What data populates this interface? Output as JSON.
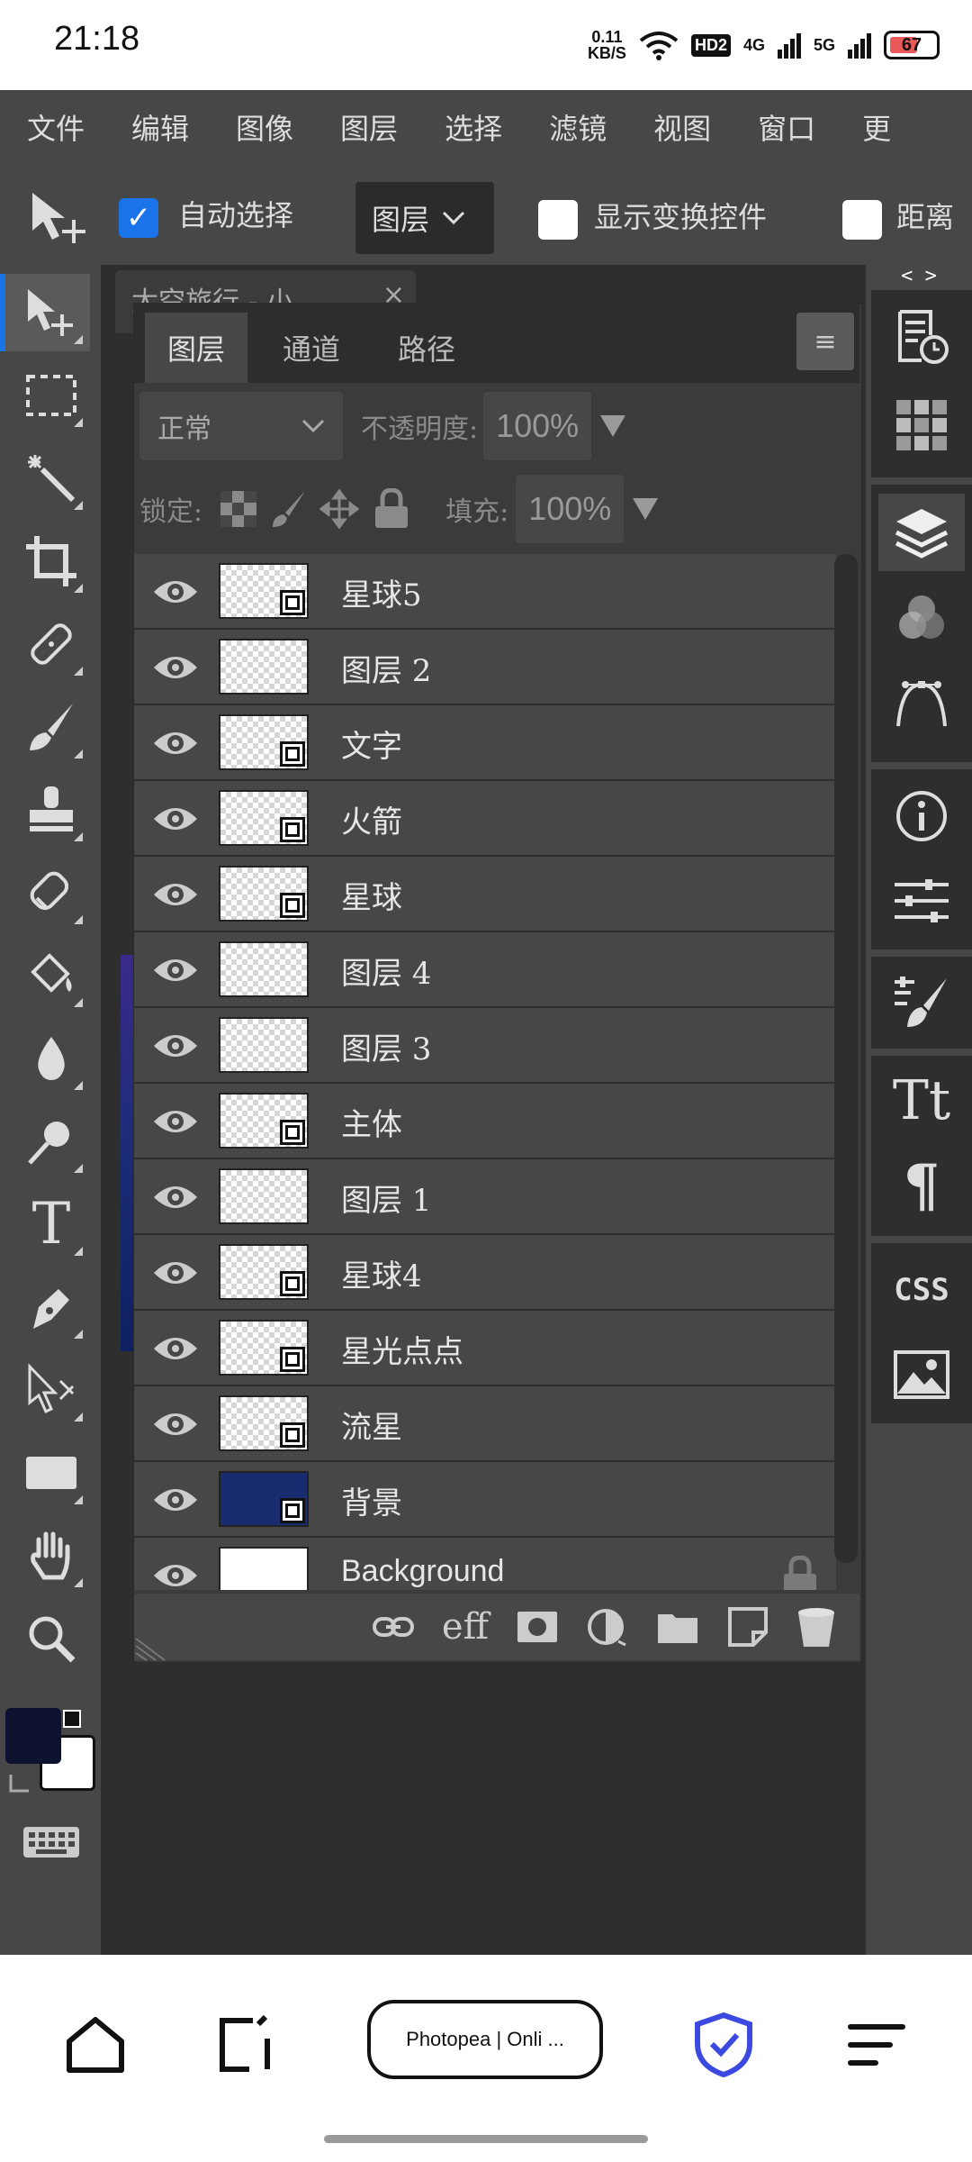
{
  "status": {
    "time": "21:18",
    "net_speed": "0.11",
    "net_unit": "KB/S",
    "hd": "HD2",
    "sig1": "4G",
    "sig2": "5G",
    "battery": "67"
  },
  "menu": [
    "文件",
    "编辑",
    "图像",
    "图层",
    "选择",
    "滤镜",
    "视图",
    "窗口",
    "更"
  ],
  "options": {
    "auto_select_label": "自动选择",
    "auto_select_checked": true,
    "target": "图层",
    "show_transform_label": "显示变换控件",
    "distance_label": "距离"
  },
  "document_tab": {
    "title": "太空旅行 - 小",
    "close": "×"
  },
  "panel": {
    "tabs": [
      "图层",
      "通道",
      "路径"
    ],
    "menu_icon": "≡",
    "blend_mode": "正常",
    "opacity_label": "不透明度:",
    "opacity": "100%",
    "lock_label": "锁定:",
    "fill_label": "填充:",
    "fill": "100%",
    "layers": [
      {
        "name": "星球5",
        "thumb": "checker",
        "smart": true
      },
      {
        "name": "图层 2",
        "thumb": "checker",
        "smart": false
      },
      {
        "name": "文字",
        "thumb": "checker",
        "smart": true
      },
      {
        "name": "火箭",
        "thumb": "checker",
        "smart": true
      },
      {
        "name": "星球",
        "thumb": "checker",
        "smart": true
      },
      {
        "name": "图层 4",
        "thumb": "checker",
        "smart": false
      },
      {
        "name": "图层 3",
        "thumb": "checker",
        "smart": false
      },
      {
        "name": "主体",
        "thumb": "checker",
        "smart": true
      },
      {
        "name": "图层 1",
        "thumb": "checker",
        "smart": false
      },
      {
        "name": "星球4",
        "thumb": "checker",
        "smart": true
      },
      {
        "name": "星光点点",
        "thumb": "checker",
        "smart": true
      },
      {
        "name": "流星",
        "thumb": "checker",
        "smart": true
      },
      {
        "name": "背景",
        "thumb": "dark",
        "smart": true
      },
      {
        "name": "Background",
        "thumb": "plain",
        "smart": false,
        "locked": true
      }
    ],
    "footer_icons": [
      "link-icon",
      "effects-icon",
      "mask-icon",
      "adjustment-icon",
      "folder-icon",
      "new-layer-icon",
      "trash-icon"
    ],
    "footer_fx": "eff"
  },
  "right_panel": {
    "collapse": "< >",
    "css_label": "CSS",
    "text_label": "Tt",
    "para_label": "¶"
  },
  "browser": {
    "tab_label": "Photopea | Onli ..."
  },
  "colors": {
    "accent": "#1a73e8",
    "fg_swatch": "#0d1230",
    "bg_swatch": "#ffffff",
    "panel_bg": "#474747",
    "dark_bg": "#2e2e2e"
  }
}
